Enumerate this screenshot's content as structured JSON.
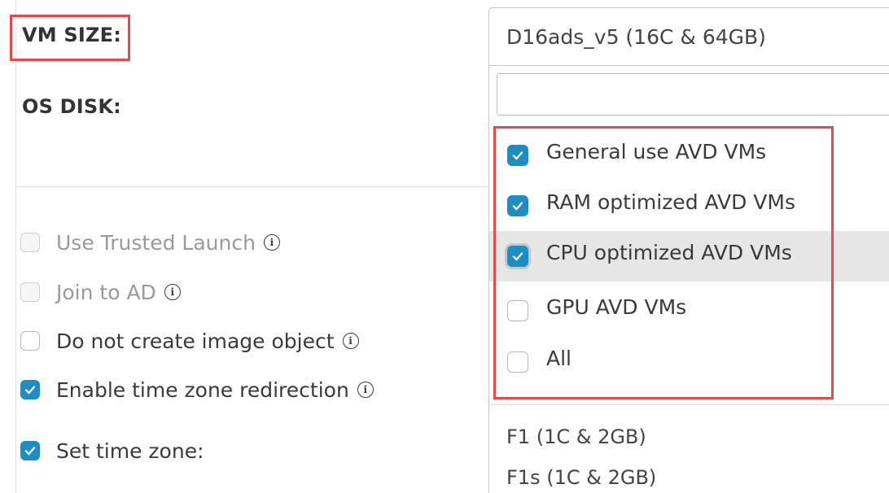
{
  "form": {
    "vm_size_label": "VM SIZE:",
    "os_disk_label": "OS DISK:",
    "options": [
      {
        "label": "Use Trusted Launch",
        "checked": false,
        "disabled": true,
        "info": true
      },
      {
        "label": "Join to AD",
        "checked": false,
        "disabled": true,
        "info": true
      },
      {
        "label": "Do not create image object",
        "checked": false,
        "disabled": false,
        "info": true
      },
      {
        "label": "Enable time zone redirection",
        "checked": true,
        "disabled": false,
        "info": true
      },
      {
        "label": "Set time zone:",
        "checked": true,
        "disabled": false,
        "info": false
      }
    ]
  },
  "dropdown": {
    "selected_value": "D16ads_v5 (16C & 64GB)",
    "search_value": "",
    "filters": [
      {
        "label": "General use AVD VMs",
        "checked": true
      },
      {
        "label": "RAM optimized AVD VMs",
        "checked": true
      },
      {
        "label": "CPU optimized AVD VMs",
        "checked": true,
        "hovered": true
      },
      {
        "label": "GPU AVD VMs",
        "checked": false
      },
      {
        "label": "All",
        "checked": false
      }
    ],
    "size_options": [
      "F1 (1C & 2GB)",
      "F1s (1C & 2GB)"
    ]
  },
  "colors": {
    "accent": "#1e8dc3",
    "highlight_box": "#e5484d",
    "hover_row": "#e6e6e6"
  },
  "icons": {
    "check": "checkmark-icon",
    "info": "info-circle-icon"
  }
}
